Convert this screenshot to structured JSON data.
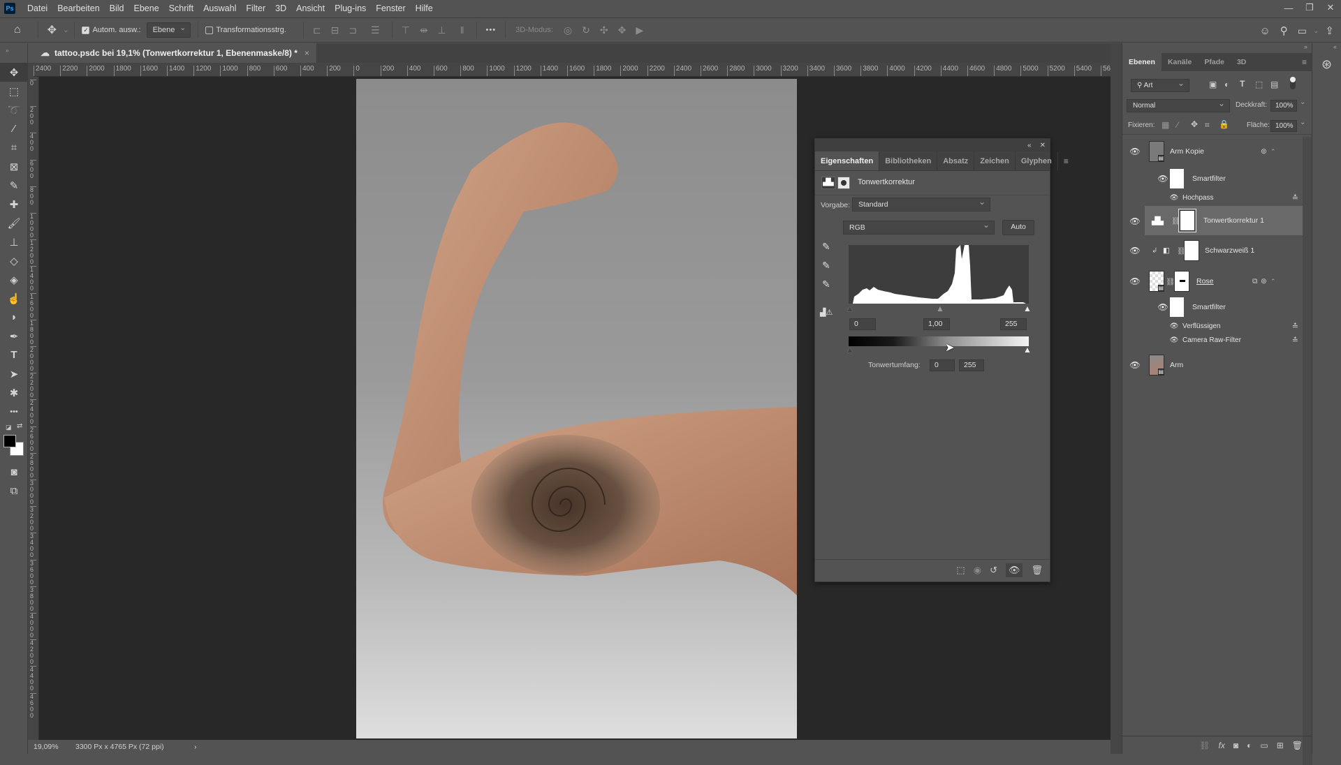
{
  "app": {
    "logo": "Ps"
  },
  "menu": [
    "Datei",
    "Bearbeiten",
    "Bild",
    "Ebene",
    "Schrift",
    "Auswahl",
    "Filter",
    "3D",
    "Ansicht",
    "Plug-ins",
    "Fenster",
    "Hilfe"
  ],
  "window_controls": {
    "minimize": "—",
    "restore": "❐",
    "close": "✕"
  },
  "options_bar": {
    "auto_select_label": "Autom. ausw.:",
    "auto_select_checked": true,
    "auto_select_target": "Ebene",
    "transform_label": "Transformationsstrg.",
    "transform_checked": false,
    "more_label": "•••",
    "mode_3d_label": "3D-Modus:"
  },
  "document_tab": {
    "title": "tattoo.psdc bei 19,1% (Tonwertkorrektur 1, Ebenenmaske/8) *",
    "close": "×"
  },
  "ruler_top": [
    "2400",
    "2200",
    "2000",
    "1800",
    "1600",
    "1400",
    "1200",
    "1000",
    "800",
    "600",
    "400",
    "200",
    "0",
    "200",
    "400",
    "600",
    "800",
    "1000",
    "1200",
    "1400",
    "1600",
    "1800",
    "2000",
    "2200",
    "2400",
    "2600",
    "2800",
    "3000",
    "3200",
    "3400",
    "3600",
    "3800",
    "4000",
    "4200",
    "4400",
    "4600",
    "4800",
    "5000",
    "5200",
    "5400",
    "56"
  ],
  "ruler_left": [
    "0",
    "200",
    "400",
    "600",
    "800",
    "1000",
    "1200",
    "1400",
    "1600",
    "1800",
    "2000",
    "2200",
    "2400",
    "2600",
    "2800",
    "3000",
    "3200",
    "3400",
    "3600",
    "3800",
    "4000",
    "4200",
    "4400",
    "4600"
  ],
  "status_bar": {
    "zoom": "19,09%",
    "doc_info": "3300 Px x 4765 Px (72 ppi)",
    "arrow": "›"
  },
  "properties": {
    "tabs": [
      "Eigenschaften",
      "Bibliotheken",
      "Absatz",
      "Zeichen",
      "Glyphen"
    ],
    "active_tab": 0,
    "title": "Tonwertkorrektur",
    "preset_label": "Vorgabe:",
    "preset_value": "Standard",
    "channel": "RGB",
    "auto_label": "Auto",
    "input_black": "0",
    "input_gamma": "1,00",
    "input_white": "255",
    "output_label": "Tonwertumfang:",
    "output_black": "0",
    "output_white": "255"
  },
  "layers_panel": {
    "tabs": [
      "Ebenen",
      "Kanäle",
      "Pfade",
      "3D"
    ],
    "active_tab": 0,
    "filter_kind": "Art",
    "blend_mode": "Normal",
    "opacity_label": "Deckkraft:",
    "opacity": "100%",
    "lock_label": "Fixieren:",
    "fill_label": "Fläche:",
    "fill": "100%",
    "layers": [
      {
        "name": "Arm Kopie",
        "visible": true,
        "smartfilter": "Smartfilter",
        "filters": [
          "Hochpass"
        ]
      },
      {
        "name": "Tonwertkorrektur 1",
        "visible": true,
        "selected": true
      },
      {
        "name": "Schwarzweiß 1",
        "visible": true,
        "clipped": true
      },
      {
        "name": "Rose",
        "visible": true,
        "smartfilter": "Smartfilter",
        "filters": [
          "Verflüssigen",
          "Camera Raw-Filter"
        ]
      },
      {
        "name": "Arm",
        "visible": true
      }
    ]
  }
}
